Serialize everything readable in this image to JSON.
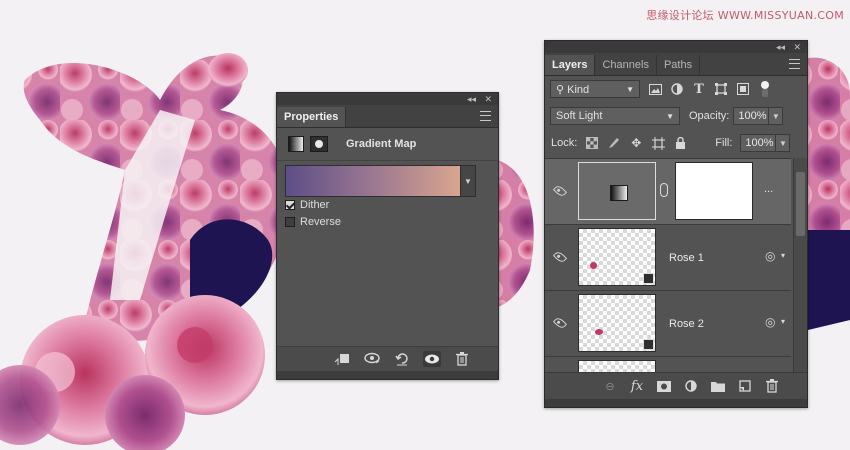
{
  "watermark": "思缘设计论坛 WWW.MISSYUAN.COM",
  "colors": {
    "gradient_start": "#5d4e87",
    "gradient_mid": "#9c7891",
    "gradient_end": "#d9a58f",
    "panel_bg": "#535353"
  },
  "properties": {
    "tab": "Properties",
    "title": "Gradient Map",
    "options": [
      {
        "label": "Dither",
        "checked": true
      },
      {
        "label": "Reverse",
        "checked": false
      }
    ],
    "footer_icons": [
      "clip-to-layer-icon",
      "view-previous-icon",
      "reset-icon",
      "visibility-icon",
      "trash-icon"
    ]
  },
  "layers": {
    "tabs": [
      "Layers",
      "Channels",
      "Paths"
    ],
    "kind_label": "Kind",
    "blend_mode": "Soft Light",
    "opacity_label": "Opacity:",
    "opacity": "100%",
    "lock_label": "Lock:",
    "fill_label": "Fill:",
    "fill": "100%",
    "adjustment_more": "...",
    "items": [
      {
        "name": "",
        "type": "adjustment"
      },
      {
        "name": "Rose 1",
        "type": "smart-object"
      },
      {
        "name": "Rose 2",
        "type": "smart-object"
      }
    ]
  }
}
